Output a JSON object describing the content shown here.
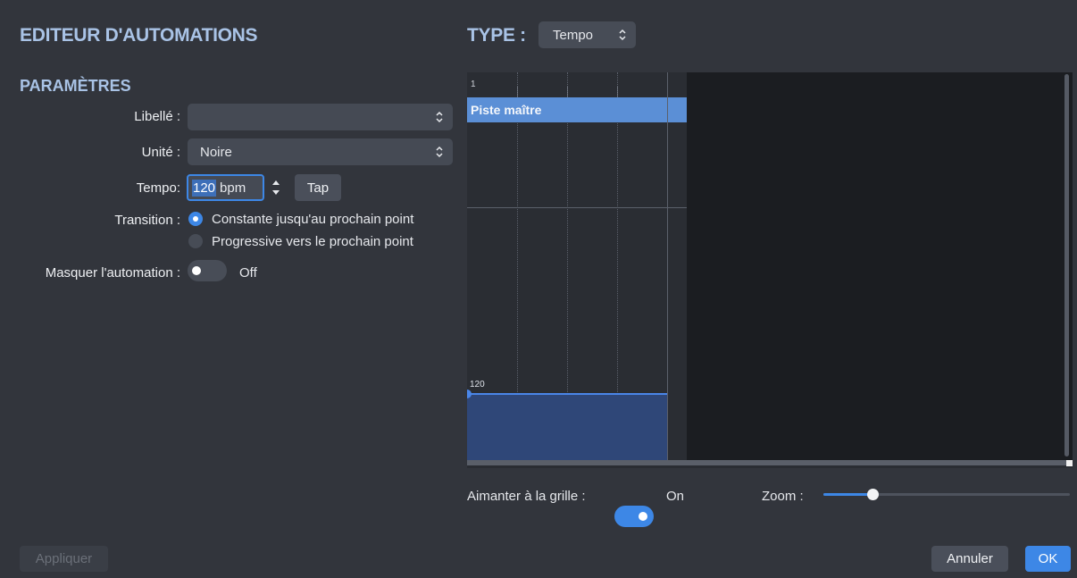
{
  "header": {
    "title": "EDITEUR D'AUTOMATIONS",
    "type_label": "TYPE :",
    "type_value": "Tempo"
  },
  "params": {
    "section_title": "PARAMÈTRES",
    "libelle_label": "Libellé :",
    "libelle_value": "",
    "unite_label": "Unité :",
    "unite_value": "Noire",
    "tempo_label": "Tempo:",
    "tempo_value": "120",
    "tempo_unit": "bpm",
    "tap_label": "Tap",
    "transition_label": "Transition :",
    "transition_options": [
      {
        "label": "Constante jusqu'au prochain point",
        "selected": true
      },
      {
        "label": "Progressive vers le prochain point",
        "selected": false
      }
    ],
    "masquer_label": "Masquer l'automation :",
    "masquer_state": "Off"
  },
  "timeline": {
    "bar_number": "1",
    "track_name": "Piste maître",
    "point_value": "120"
  },
  "bottom": {
    "snap_label": "Aimanter à la grille :",
    "snap_state": "On",
    "zoom_label": "Zoom :",
    "zoom_level": 0.2
  },
  "footer": {
    "apply_label": "Appliquer",
    "cancel_label": "Annuler",
    "ok_label": "OK"
  },
  "colors": {
    "accent": "#3d87e6",
    "track_header": "#5b8fd6",
    "automation_fill": "#2f4778"
  }
}
